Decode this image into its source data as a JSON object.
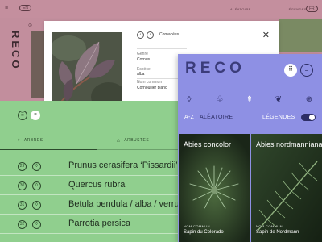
{
  "back_screen": {
    "brand": "RECO",
    "menu_icon": "hamburger-icon",
    "language_top_left": "EN",
    "language_top_right": "FR",
    "header_link_left": "ALÉATOIRE",
    "header_link_right": "LÉGENDES"
  },
  "detail_card": {
    "nav_prev_icon": "chevron-left-icon",
    "nav_next_icon": "chevron-right-icon",
    "breadcrumb": "Cornacées",
    "fields": [
      {
        "key": "Genre",
        "value": "Cornus"
      },
      {
        "key": "Espèce",
        "value": "alba"
      },
      {
        "key": "Nom commun",
        "value": "Cornouiller blanc"
      }
    ],
    "close_icon": "close-icon"
  },
  "list_panel": {
    "view_buttons": [
      {
        "icon": "grid-icon",
        "glyph": "⠿"
      },
      {
        "icon": "list-icon",
        "glyph": "="
      }
    ],
    "categories": [
      {
        "icon": "leaf-icon",
        "glyph": "◊",
        "label": "ARBRES"
      },
      {
        "icon": "shrub-icon",
        "glyph": "△",
        "label": "ARBUSTES"
      }
    ],
    "rows": [
      {
        "num": "29",
        "glyph": "◊",
        "name": "Prunus cerasifera ‘Pissardii’"
      },
      {
        "num": "30",
        "glyph": "◊",
        "name": "Quercus rubra"
      },
      {
        "num": "31",
        "glyph": "◊",
        "name": "Betula pendula / alba / verrucosa"
      },
      {
        "num": "32",
        "glyph": "◊",
        "name": "Parrotia persica"
      }
    ]
  },
  "front_panel": {
    "logo": "RECO",
    "grid_button_glyph": "⠿",
    "list_button_glyph": "=",
    "filter_icons": [
      {
        "icon": "leaf-icon",
        "glyph": "◊"
      },
      {
        "icon": "tree-icon",
        "glyph": "♧"
      },
      {
        "icon": "conifer-icon",
        "glyph": "⇞"
      },
      {
        "icon": "herb-icon",
        "glyph": "❦"
      },
      {
        "icon": "add-icon",
        "glyph": "⊕"
      }
    ],
    "sort_label": "A-Z",
    "random_label": "ALÉATOIRE",
    "legends_label": "LÉGENDES",
    "legends_toggle_on": true,
    "tiles": [
      {
        "name": "Abies concolor",
        "common_key": "NOM COMMUN",
        "common_value": "Sapin du Colorado"
      },
      {
        "name": "Abies nordmanniana",
        "common_key": "NOM COMMUN",
        "common_value": "Sapin de Nordmann"
      }
    ]
  },
  "colors": {
    "pink": "#c28e9d",
    "green": "#90cf8e",
    "purple": "#8e90e4",
    "indigo_text": "#2d2e66"
  }
}
